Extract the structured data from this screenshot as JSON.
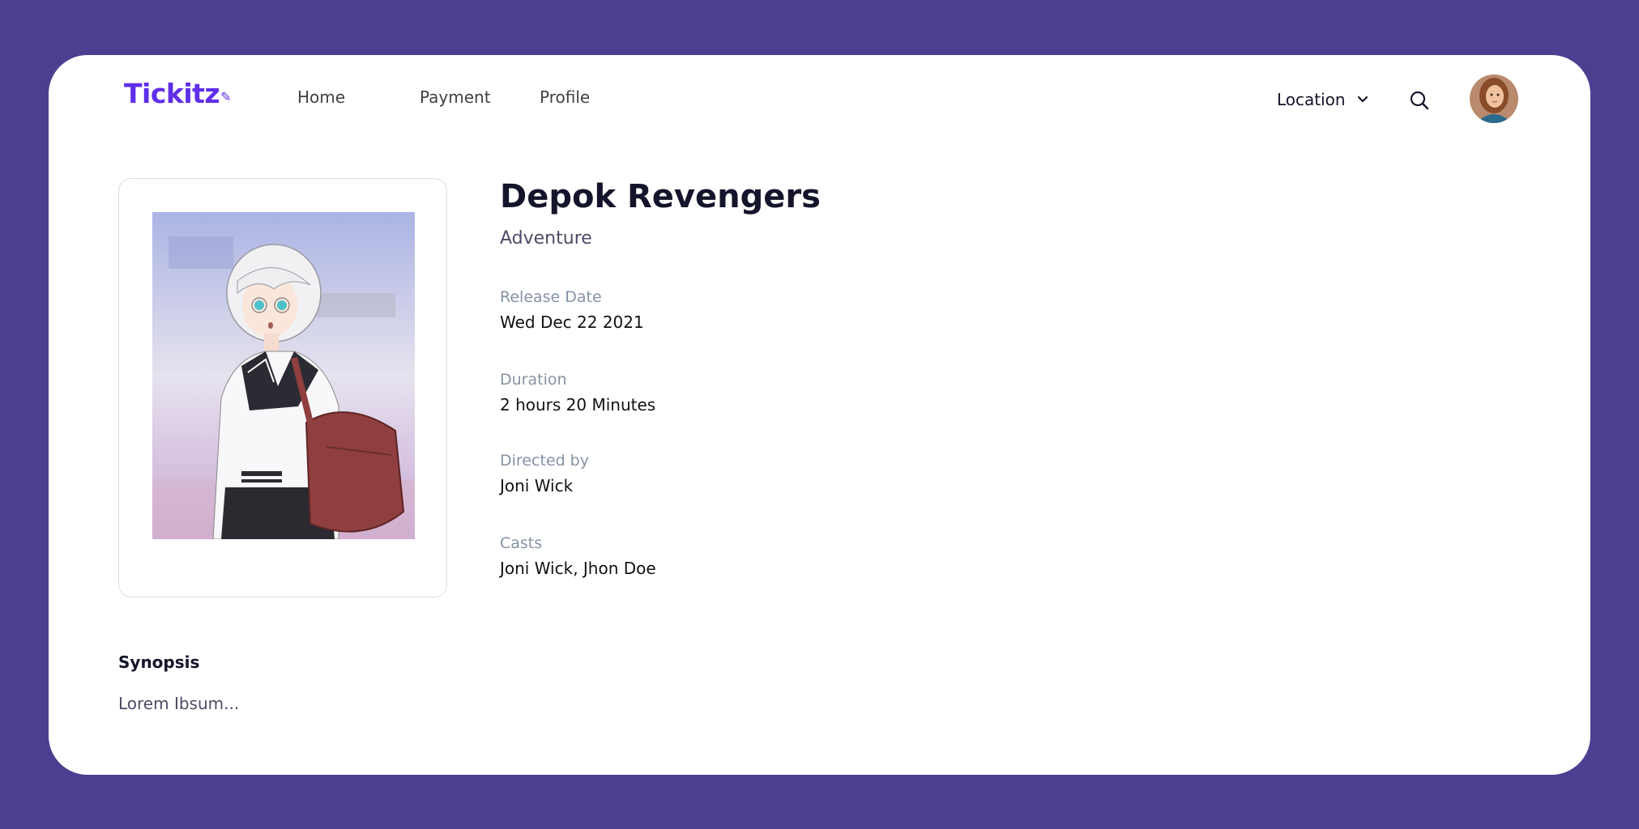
{
  "brand": {
    "name": "Tickitz",
    "mark": "🎫"
  },
  "nav": {
    "links": [
      "Home",
      "Payment",
      "Profile"
    ],
    "location_label": "Location",
    "search_icon": "search-icon",
    "avatar_icon": "user-avatar"
  },
  "movie": {
    "title": "Depok Revengers",
    "genre": "Adventure",
    "details": [
      {
        "label": "Release Date",
        "value": "Wed Dec 22 2021"
      },
      {
        "label": "Duration",
        "value": "2 hours 20 Minutes"
      },
      {
        "label": "Directed by",
        "value": "Joni Wick"
      },
      {
        "label": "Casts",
        "value": "Joni Wick, Jhon Doe"
      }
    ],
    "synopsis_title": "Synopsis",
    "synopsis": "Lorem Ibsum..."
  },
  "colors": {
    "background": "#4c3f91",
    "brand": "#5f2eea"
  }
}
